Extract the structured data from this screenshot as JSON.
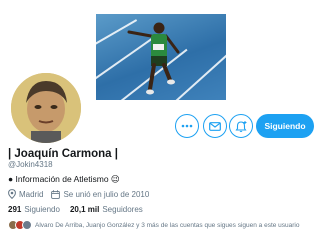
{
  "profile": {
    "name": "| Joaquín Carmona |",
    "handle": "@Jokin4318",
    "bio": "● Información de Atletismo 😉",
    "location": "Madrid",
    "joined": "Se unió en julio de 2010",
    "following_count": "291",
    "following_label": "Siguiendo",
    "followers_count": "20,1 mil",
    "followers_label": "Seguidores",
    "followers_you_know": "Alvaro De Arriba, Juanjo González y 3 más de las cuentas que sigues siguen a este usuario"
  },
  "actions": {
    "follow_label": "Siguiendo",
    "more_icon": "more-icon",
    "message_icon": "envelope-icon",
    "notify_icon": "bell-plus-icon"
  },
  "colors": {
    "accent": "#1da1f2",
    "secondary_text": "#657786",
    "primary_text": "#14171a"
  }
}
